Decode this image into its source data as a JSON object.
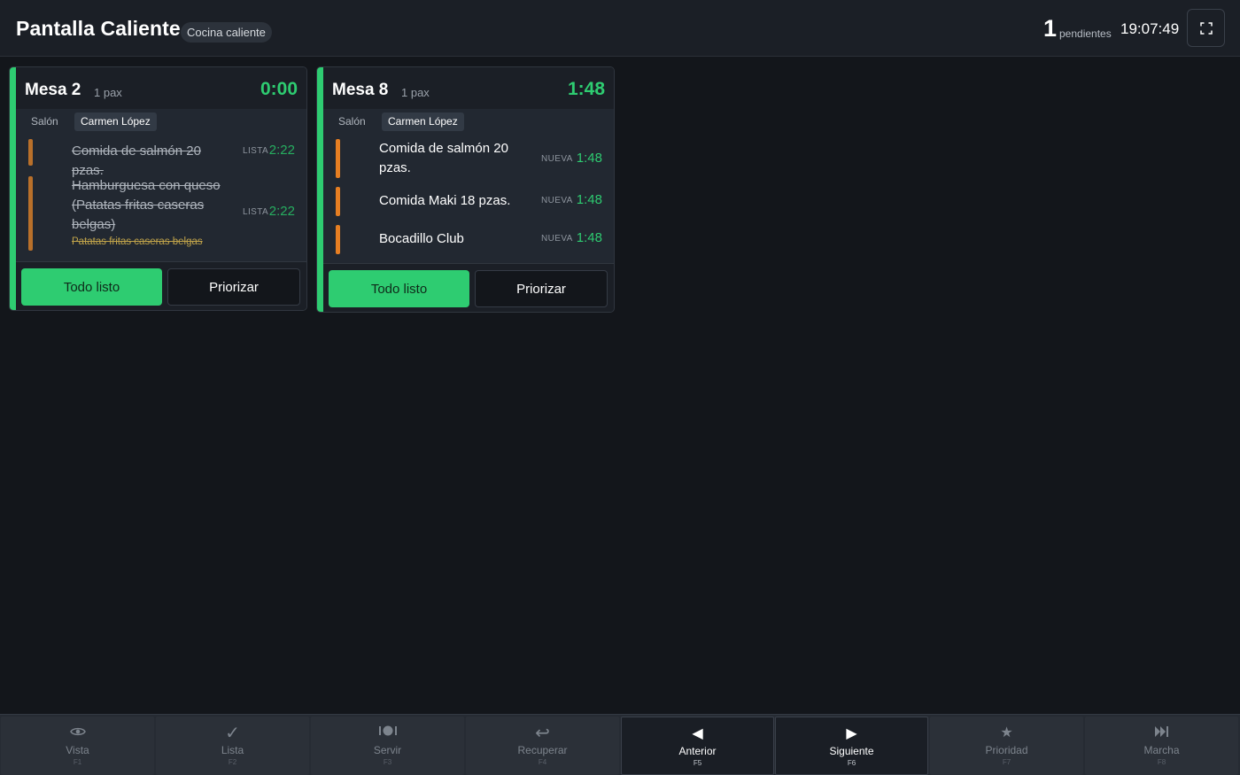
{
  "header": {
    "title": "Pantalla Caliente",
    "station": "Cocina caliente",
    "pending_count": "1",
    "pending_label": "pendientes",
    "clock": "19:07:49",
    "fullscreen_icon": "fullscreen-icon"
  },
  "orders": [
    {
      "table": "Mesa 2",
      "pax": "1 pax",
      "elapsed": "0:00",
      "zone": "Salón",
      "waiter": "Carmen López",
      "items": [
        {
          "name": "Comida de salmón 20 pzas.",
          "status": "LISTA",
          "time": "2:22",
          "done": true
        },
        {
          "name": "Hamburguesa con queso (Patatas fritas caseras belgas)",
          "modifier": "Patatas fritas caseras belgas",
          "status": "LISTA",
          "time": "2:22",
          "done": true
        }
      ],
      "ready_label": "Todo listo",
      "priority_label": "Priorizar"
    },
    {
      "table": "Mesa 8",
      "pax": "1 pax",
      "elapsed": "1:48",
      "zone": "Salón",
      "waiter": "Carmen López",
      "items": [
        {
          "name": "Comida de salmón 20 pzas.",
          "status": "NUEVA",
          "time": "1:48",
          "done": false
        },
        {
          "name": "Comida Maki 18 pzas.",
          "status": "NUEVA",
          "time": "1:48",
          "done": false
        },
        {
          "name": "Bocadillo Club",
          "status": "NUEVA",
          "time": "1:48",
          "done": false
        }
      ],
      "ready_label": "Todo listo",
      "priority_label": "Priorizar"
    }
  ],
  "toolbar": [
    {
      "label": "Vista",
      "key": "F1",
      "icon": "eye-icon",
      "glyph": "👁",
      "active": false
    },
    {
      "label": "Lista",
      "key": "F2",
      "icon": "check-icon",
      "glyph": "✓",
      "active": false
    },
    {
      "label": "Servir",
      "key": "F3",
      "icon": "serve-dish-icon",
      "glyph": "🍽",
      "active": false
    },
    {
      "label": "Recuperar",
      "key": "F4",
      "icon": "undo-arrow-icon",
      "glyph": "↩",
      "active": false
    },
    {
      "label": "Anterior",
      "key": "F5",
      "icon": "triangle-left-icon",
      "glyph": "◀",
      "active": true
    },
    {
      "label": "Siguiente",
      "key": "F6",
      "icon": "triangle-right-icon",
      "glyph": "▶",
      "active": true
    },
    {
      "label": "Prioridad",
      "key": "F7",
      "icon": "star-icon",
      "glyph": "★",
      "active": false
    },
    {
      "label": "Marcha",
      "key": "F8",
      "icon": "skip-forward-icon",
      "glyph": "⏭",
      "active": false
    }
  ],
  "colors": {
    "accent_green": "#2ecc71",
    "item_bar_orange": "#e67e22",
    "background": "#13161b",
    "header_bg": "#1b1f26"
  }
}
